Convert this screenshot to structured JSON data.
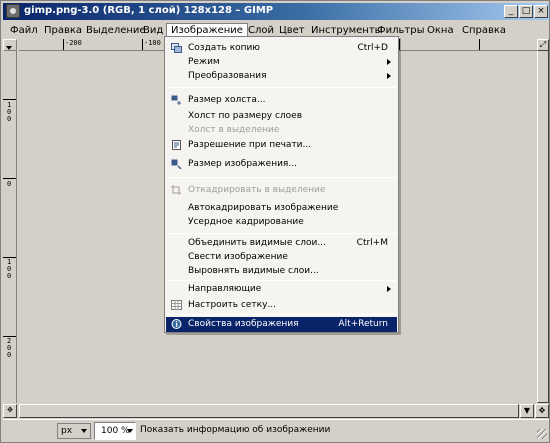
{
  "window": {
    "title": "gimp.png-3.0 (RGB, 1 слой) 128x128 – GIMP",
    "minimize": "_",
    "maximize": "□",
    "close": "×"
  },
  "menubar": {
    "items": [
      "Файл",
      "Правка",
      "Выделение",
      "Вид",
      "Изображение",
      "Слой",
      "Цвет",
      "Инструменты",
      "Фильтры",
      "Окна",
      "Справка"
    ],
    "active_index": 4
  },
  "rulers": {
    "h_labels": [
      "-200",
      "-100"
    ],
    "v_labels": [
      "1\n0\n0",
      "0",
      "1\n0\n0",
      "2\n0\n0"
    ]
  },
  "image_menu": {
    "items": [
      {
        "label": "Создать копию",
        "shortcut": "Ctrl+D",
        "icon": "duplicate-icon",
        "state": "normal"
      },
      {
        "label": "Режим",
        "submenu": true,
        "state": "normal"
      },
      {
        "label": "Преобразования",
        "submenu": true,
        "state": "normal"
      },
      {
        "separator": true
      },
      {
        "label": "Размер холста...",
        "icon": "canvas-size-icon",
        "state": "normal"
      },
      {
        "label": "Холст по размеру слоев",
        "state": "normal"
      },
      {
        "label": "Холст в выделение",
        "state": "disabled"
      },
      {
        "label": "Разрешение при печати...",
        "icon": "print-size-icon",
        "state": "normal"
      },
      {
        "label": "Размер изображения...",
        "icon": "scale-image-icon",
        "state": "normal"
      },
      {
        "separator": true
      },
      {
        "label": "Откадрировать в выделение",
        "icon": "crop-icon",
        "state": "disabled"
      },
      {
        "label": "Автокадрировать изображение",
        "state": "normal"
      },
      {
        "label": "Усердное кадрирование",
        "state": "normal"
      },
      {
        "separator": true
      },
      {
        "label": "Объединить видимые слои...",
        "shortcut": "Ctrl+M",
        "state": "normal"
      },
      {
        "label": "Свести изображение",
        "state": "normal"
      },
      {
        "label": "Выровнять видимые слои...",
        "state": "normal"
      },
      {
        "separator": true
      },
      {
        "label": "Направляющие",
        "submenu": true,
        "state": "normal"
      },
      {
        "label": "Настроить сетку...",
        "icon": "grid-icon",
        "state": "normal"
      },
      {
        "separator": true
      },
      {
        "label": "Свойства изображения",
        "shortcut": "Alt+Return",
        "icon": "info-icon",
        "state": "highlighted"
      }
    ]
  },
  "statusbar": {
    "unit": "px",
    "zoom": "100 %",
    "message": "Показать информацию об изображении"
  },
  "colors": {
    "highlight": "#0a246a",
    "face": "#d4d0c8"
  }
}
